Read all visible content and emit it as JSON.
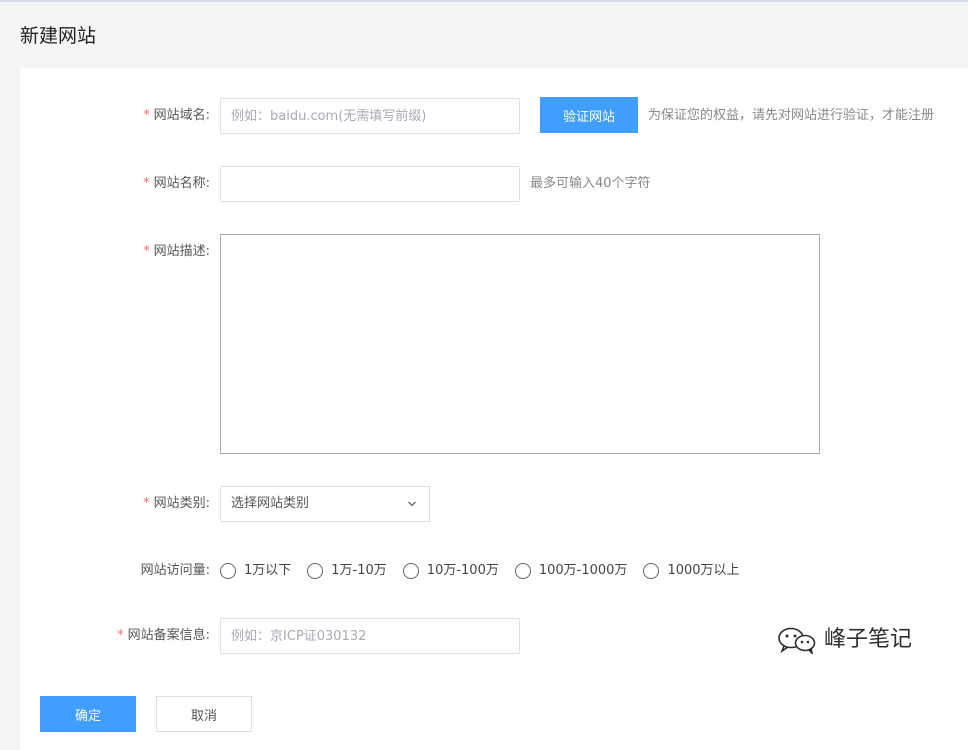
{
  "page": {
    "title": "新建网站"
  },
  "form": {
    "domain": {
      "label": "网站域名:",
      "placeholder": "例如：baidu.com(无需填写前缀)",
      "verify_button": "验证网站",
      "hint": "为保证您的权益，请先对网站进行验证，才能注册"
    },
    "name": {
      "label": "网站名称:",
      "hint": "最多可输入40个字符"
    },
    "description": {
      "label": "网站描述:"
    },
    "category": {
      "label": "网站类别:",
      "selected": "选择网站类别"
    },
    "traffic": {
      "label": "网站访问量:",
      "options": [
        "1万以下",
        "1万-10万",
        "10万-100万",
        "100万-1000万",
        "1000万以上"
      ]
    },
    "icp": {
      "label": "网站备案信息:",
      "placeholder": "例如：京ICP证030132"
    },
    "required_mark": "*"
  },
  "actions": {
    "confirm": "确定",
    "cancel": "取消"
  },
  "watermark": {
    "text": "峰子笔记",
    "icon": "wechat-icon"
  },
  "colors": {
    "primary": "#409eff",
    "required": "#f56c6c",
    "background": "#f4f5f7"
  }
}
